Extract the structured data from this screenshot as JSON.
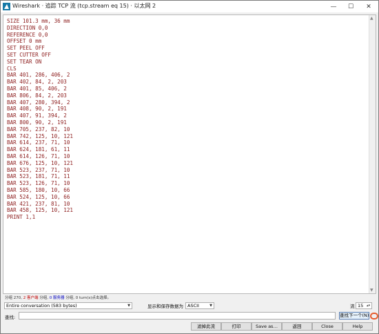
{
  "window": {
    "title": "Wireshark · 追踪 TCP 流 (tcp.stream eq 15) · 以太网 2",
    "icon": "wireshark-fin-icon",
    "controls": {
      "minimize": "—",
      "maximize": "☐",
      "close": "✕"
    }
  },
  "stream_text": [
    "SIZE 101.3 mm, 36 mm",
    "DIRECTION 0,0",
    "REFERENCE 0,0",
    "OFFSET 0 mm",
    "SET PEEL OFF",
    "SET CUTTER OFF",
    "SET TEAR ON",
    "CLS",
    "BAR 401, 286, 406, 2",
    "BAR 402, 84, 2, 203",
    "BAR 401, 85, 406, 2",
    "BAR 806, 84, 2, 203",
    "BAR 407, 280, 394, 2",
    "BAR 408, 90, 2, 191",
    "BAR 407, 91, 394, 2",
    "BAR 800, 90, 2, 191",
    "BAR 705, 237, 82, 10",
    "BAR 742, 125, 10, 121",
    "BAR 614, 237, 71, 10",
    "BAR 624, 181, 61, 11",
    "BAR 614, 126, 71, 10",
    "BAR 676, 125, 10, 121",
    "BAR 523, 237, 71, 10",
    "BAR 523, 181, 71, 11",
    "BAR 523, 126, 71, 10",
    "BAR 585, 180, 10, 66",
    "BAR 524, 125, 10, 66",
    "BAR 421, 237, 81, 10",
    "BAR 458, 125, 10, 121",
    "PRINT 1,1"
  ],
  "status": {
    "part1": "分组 270,",
    "client_pkts": "2 客户端",
    "part2": "分组,",
    "server_pkts": "0 服务器",
    "part3": "分组,",
    "part4": "0 turn(s)点击选择。"
  },
  "controls": {
    "conversation_select": "Entire conversation (583 bytes)",
    "format_label": "显示和保存数据为",
    "encoding_select": "ASCII",
    "stream_label": "流",
    "stream_number": "15",
    "find_label": "查找:",
    "find_value": "",
    "find_next": "查找下一个(N)"
  },
  "buttons": {
    "filter_out": "滤掉此流",
    "print": "打印",
    "save_as": "Save as…",
    "back": "返回",
    "close": "Close",
    "help": "Help"
  },
  "colors": {
    "client_text": "#8b1a1a",
    "client_label": "#c00000",
    "server_label": "#0000c0",
    "highlight": "#e65a2a"
  }
}
